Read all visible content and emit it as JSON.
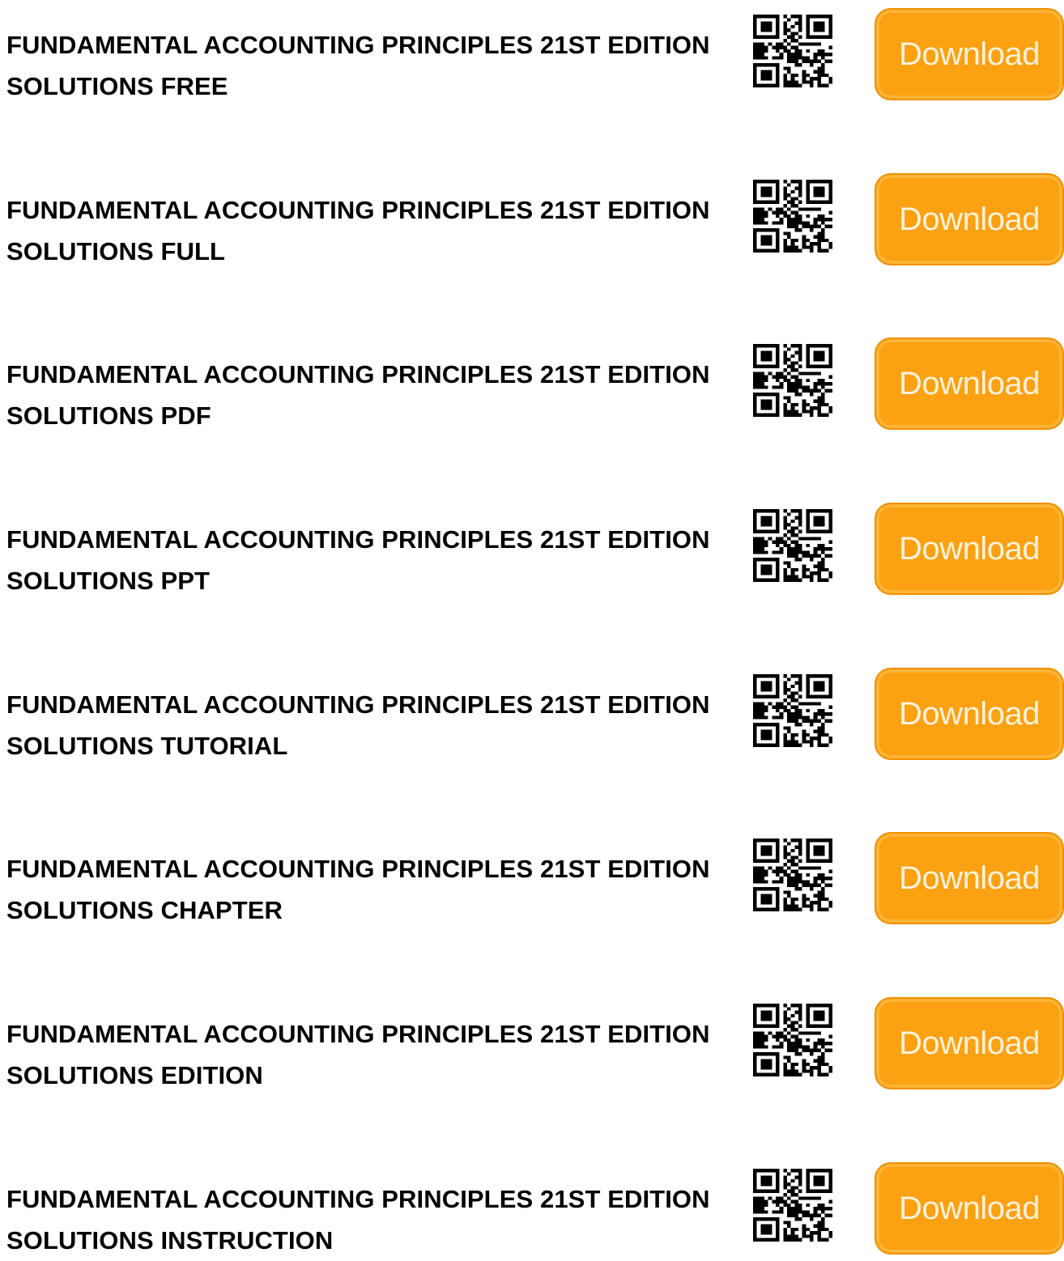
{
  "theme": {
    "button_color": "#fba112",
    "text_color": "#000000"
  },
  "qr_icon": "qr-code-icon",
  "items": [
    {
      "line1": "FUNDAMENTAL ACCOUNTING PRINCIPLES 21ST EDITION",
      "line2": "SOLUTIONS FREE",
      "button_label": "Download"
    },
    {
      "line1": "FUNDAMENTAL ACCOUNTING PRINCIPLES 21ST EDITION",
      "line2": "SOLUTIONS FULL",
      "button_label": "Download"
    },
    {
      "line1": "FUNDAMENTAL ACCOUNTING PRINCIPLES 21ST EDITION",
      "line2": "SOLUTIONS PDF",
      "button_label": "Download"
    },
    {
      "line1": "FUNDAMENTAL ACCOUNTING PRINCIPLES 21ST EDITION",
      "line2": "SOLUTIONS PPT",
      "button_label": "Download"
    },
    {
      "line1": "FUNDAMENTAL ACCOUNTING PRINCIPLES 21ST EDITION",
      "line2": "SOLUTIONS TUTORIAL",
      "button_label": "Download"
    },
    {
      "line1": "FUNDAMENTAL ACCOUNTING PRINCIPLES 21ST EDITION",
      "line2": "SOLUTIONS CHAPTER",
      "button_label": "Download"
    },
    {
      "line1": "FUNDAMENTAL ACCOUNTING PRINCIPLES 21ST EDITION",
      "line2": "SOLUTIONS EDITION",
      "button_label": "Download"
    },
    {
      "line1": "FUNDAMENTAL ACCOUNTING PRINCIPLES 21ST EDITION",
      "line2": "SOLUTIONS INSTRUCTION",
      "button_label": "Download"
    }
  ]
}
